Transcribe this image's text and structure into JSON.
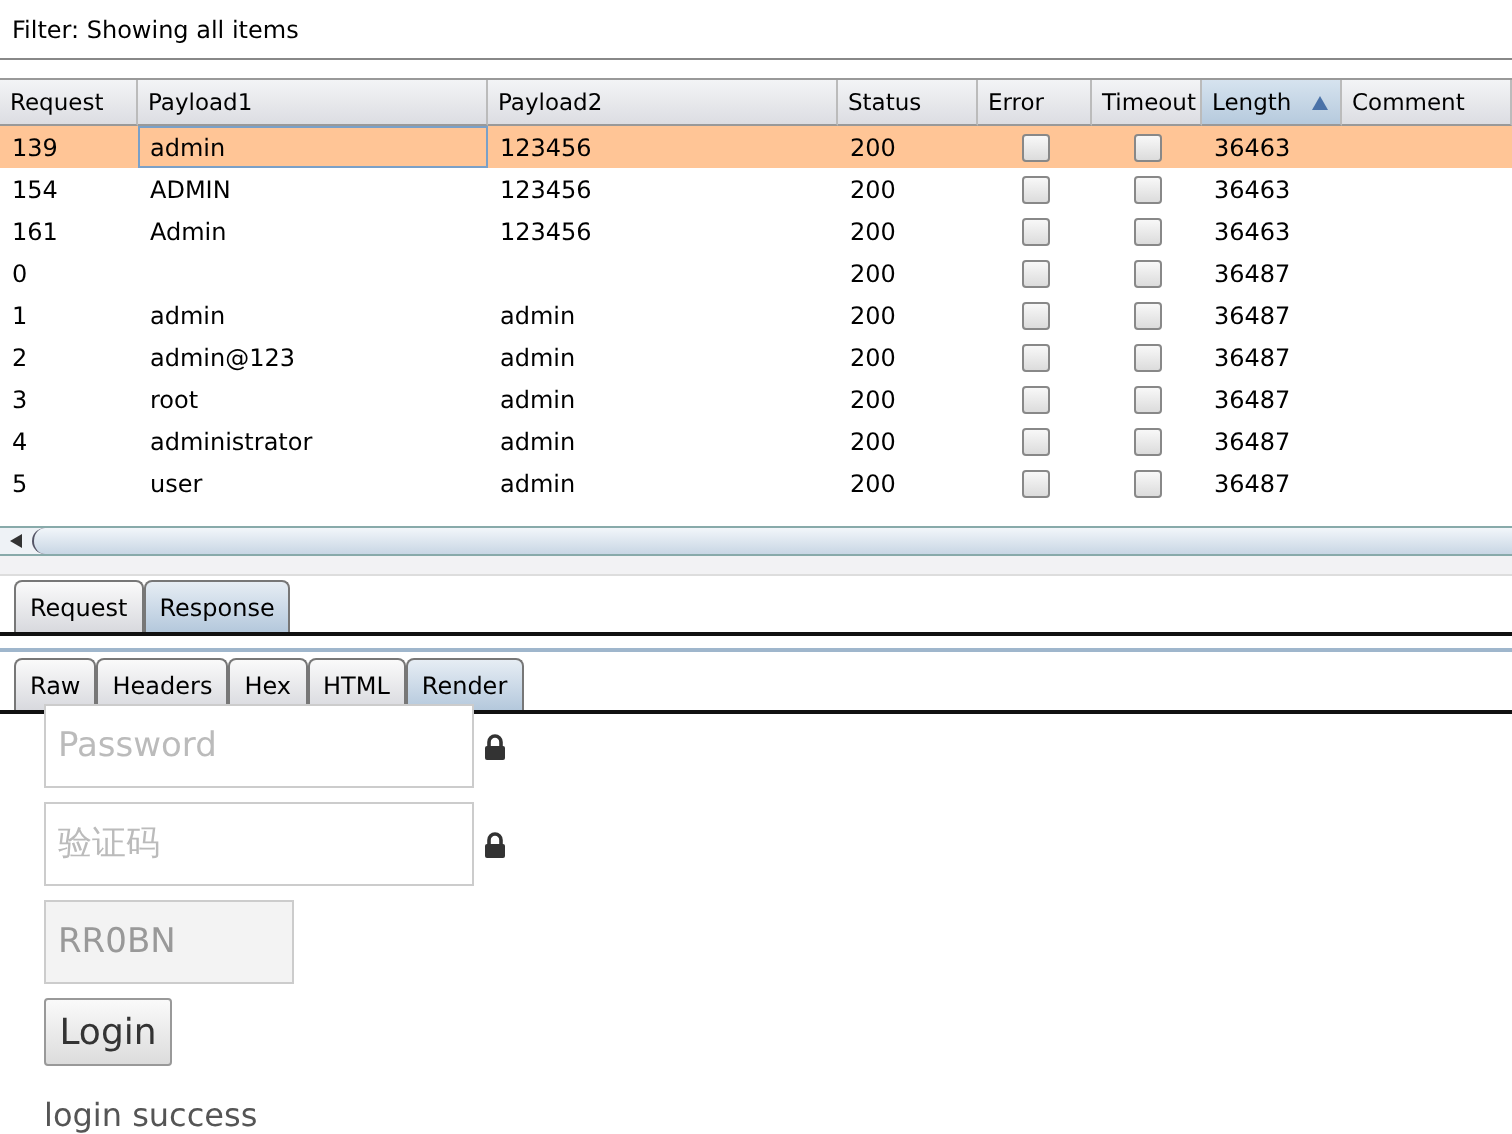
{
  "filter": {
    "label": "Filter: Showing all items"
  },
  "table": {
    "columns": [
      {
        "label": "Request",
        "sorted": false
      },
      {
        "label": "Payload1",
        "sorted": false
      },
      {
        "label": "Payload2",
        "sorted": false
      },
      {
        "label": "Status",
        "sorted": false
      },
      {
        "label": "Error",
        "sorted": false
      },
      {
        "label": "Timeout",
        "sorted": false
      },
      {
        "label": "Length",
        "sorted": true
      },
      {
        "label": "Comment",
        "sorted": false
      }
    ],
    "rows": [
      {
        "request": "139",
        "payload1": "admin",
        "payload2": "123456",
        "status": "200",
        "error": false,
        "timeout": false,
        "length": "36463",
        "selected": true
      },
      {
        "request": "154",
        "payload1": "ADMIN",
        "payload2": "123456",
        "status": "200",
        "error": false,
        "timeout": false,
        "length": "36463",
        "selected": false
      },
      {
        "request": "161",
        "payload1": "Admin",
        "payload2": "123456",
        "status": "200",
        "error": false,
        "timeout": false,
        "length": "36463",
        "selected": false
      },
      {
        "request": "0",
        "payload1": "",
        "payload2": "",
        "status": "200",
        "error": false,
        "timeout": false,
        "length": "36487",
        "selected": false
      },
      {
        "request": "1",
        "payload1": "admin",
        "payload2": "admin",
        "status": "200",
        "error": false,
        "timeout": false,
        "length": "36487",
        "selected": false
      },
      {
        "request": "2",
        "payload1": "admin@123",
        "payload2": "admin",
        "status": "200",
        "error": false,
        "timeout": false,
        "length": "36487",
        "selected": false
      },
      {
        "request": "3",
        "payload1": "root",
        "payload2": "admin",
        "status": "200",
        "error": false,
        "timeout": false,
        "length": "36487",
        "selected": false
      },
      {
        "request": "4",
        "payload1": "administrator",
        "payload2": "admin",
        "status": "200",
        "error": false,
        "timeout": false,
        "length": "36487",
        "selected": false
      },
      {
        "request": "5",
        "payload1": "user",
        "payload2": "admin",
        "status": "200",
        "error": false,
        "timeout": false,
        "length": "36487",
        "selected": false
      }
    ]
  },
  "tabs": [
    {
      "label": "Request",
      "selected": false
    },
    {
      "label": "Response",
      "selected": true
    }
  ],
  "view_tabs": [
    {
      "label": "Raw",
      "selected": false
    },
    {
      "label": "Headers",
      "selected": false
    },
    {
      "label": "Hex",
      "selected": false
    },
    {
      "label": "HTML",
      "selected": false
    },
    {
      "label": "Render",
      "selected": true
    }
  ],
  "render": {
    "password": {
      "placeholder": "Password"
    },
    "captcha_input": {
      "placeholder": "验证码"
    },
    "captcha": {
      "text": "RR0BN"
    },
    "login_button": "Login",
    "message": "login success"
  }
}
